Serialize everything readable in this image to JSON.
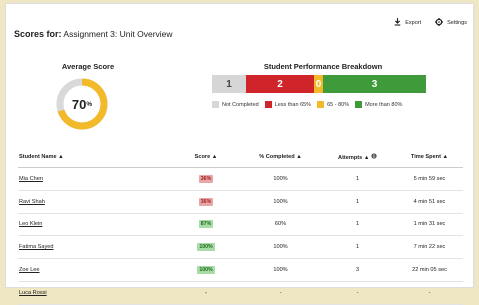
{
  "header": {
    "title_bold": "Scores for:",
    "title_rest": " Assignment 3: Unit Overview",
    "export_label": "Export",
    "settings_label": "Settings"
  },
  "average": {
    "title": "Average Score",
    "value": "70",
    "unit": "%",
    "fraction": 0.7,
    "ring_color": "#f2b92a",
    "track_color": "#d9d9d9"
  },
  "breakdown": {
    "title": "Student Performance Breakdown",
    "segments": [
      {
        "count": "1",
        "color": "#d6d6d6",
        "text_color": "#444"
      },
      {
        "count": "2",
        "color": "#d0242b",
        "text_color": "#ffffff"
      },
      {
        "count": "0",
        "color": "#f2b92a",
        "text_color": "#ffffff"
      },
      {
        "count": "3",
        "color": "#3f9a3a",
        "text_color": "#ffffff"
      }
    ],
    "legend": [
      {
        "label": "Not Completed",
        "color": "#d6d6d6"
      },
      {
        "label": "Less than 65%",
        "color": "#d0242b"
      },
      {
        "label": "65 - 80%",
        "color": "#f2b92a"
      },
      {
        "label": "More than 80%",
        "color": "#3f9a3a"
      }
    ]
  },
  "table": {
    "headers": {
      "name": "Student Name",
      "score": "Score",
      "completed": "% Completed",
      "attempts": "Attempts",
      "time": "Time Spent"
    },
    "sort_glyph": "▲",
    "rows": [
      {
        "name": "Mia Chen",
        "score": "36%",
        "status": "red",
        "completed": "100%",
        "attempts": "1",
        "time": "5 min 59 sec"
      },
      {
        "name": "Ravi Shah",
        "score": "36%",
        "status": "red",
        "completed": "100%",
        "attempts": "1",
        "time": "4 min 51 sec"
      },
      {
        "name": "Leo Klein",
        "score": "87%",
        "status": "green",
        "completed": "60%",
        "attempts": "1",
        "time": "1 min 31 sec"
      },
      {
        "name": "Fatima Sayed",
        "score": "100%",
        "status": "green",
        "completed": "100%",
        "attempts": "1",
        "time": "7 min 22 sec"
      },
      {
        "name": "Zoe Lee",
        "score": "100%",
        "status": "green",
        "completed": "100%",
        "attempts": "3",
        "time": "22 min 05 sec"
      },
      {
        "name": "Luca Rossi",
        "score": "-",
        "status": "none",
        "completed": "-",
        "attempts": "-",
        "time": "-"
      }
    ]
  }
}
